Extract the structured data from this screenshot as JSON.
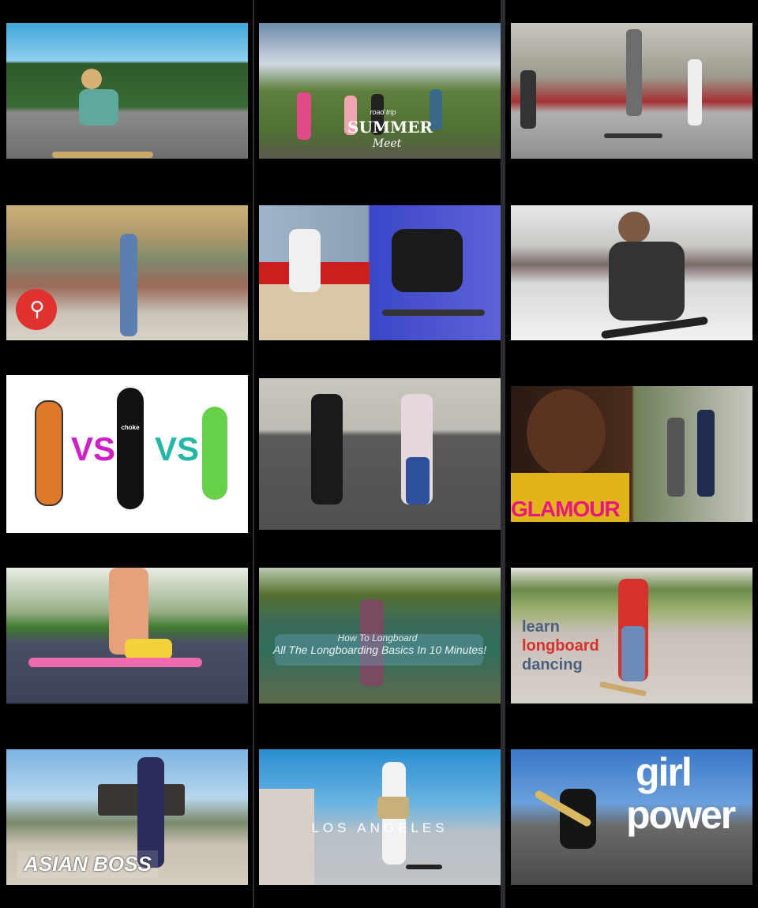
{
  "colors": {
    "background": "#2b2d31",
    "column": "#000000"
  },
  "thumbnails": [
    {
      "id": "thumb-1",
      "text": []
    },
    {
      "id": "thumb-2",
      "text": [
        "road trip",
        "SUMMER",
        "Meet"
      ]
    },
    {
      "id": "thumb-3",
      "text": []
    },
    {
      "id": "thumb-4",
      "text": []
    },
    {
      "id": "thumb-5",
      "text": []
    },
    {
      "id": "thumb-6",
      "text": []
    },
    {
      "id": "thumb-7",
      "text": [
        "VS",
        "VS",
        "choke"
      ]
    },
    {
      "id": "thumb-8",
      "text": []
    },
    {
      "id": "thumb-9",
      "text": [
        "GLAMOUR"
      ]
    },
    {
      "id": "thumb-10",
      "text": []
    },
    {
      "id": "thumb-11",
      "text": [
        "How To Longboard",
        "All The Longboarding Basics In 10 Minutes!"
      ]
    },
    {
      "id": "thumb-12",
      "text": [
        "learn",
        "longboard",
        "dancing"
      ]
    },
    {
      "id": "thumb-13",
      "text": [
        "ASIAN BOSS"
      ]
    },
    {
      "id": "thumb-14",
      "text": [
        "LOS ANGELES"
      ]
    },
    {
      "id": "thumb-15",
      "text": [
        "girl",
        "power"
      ]
    }
  ]
}
